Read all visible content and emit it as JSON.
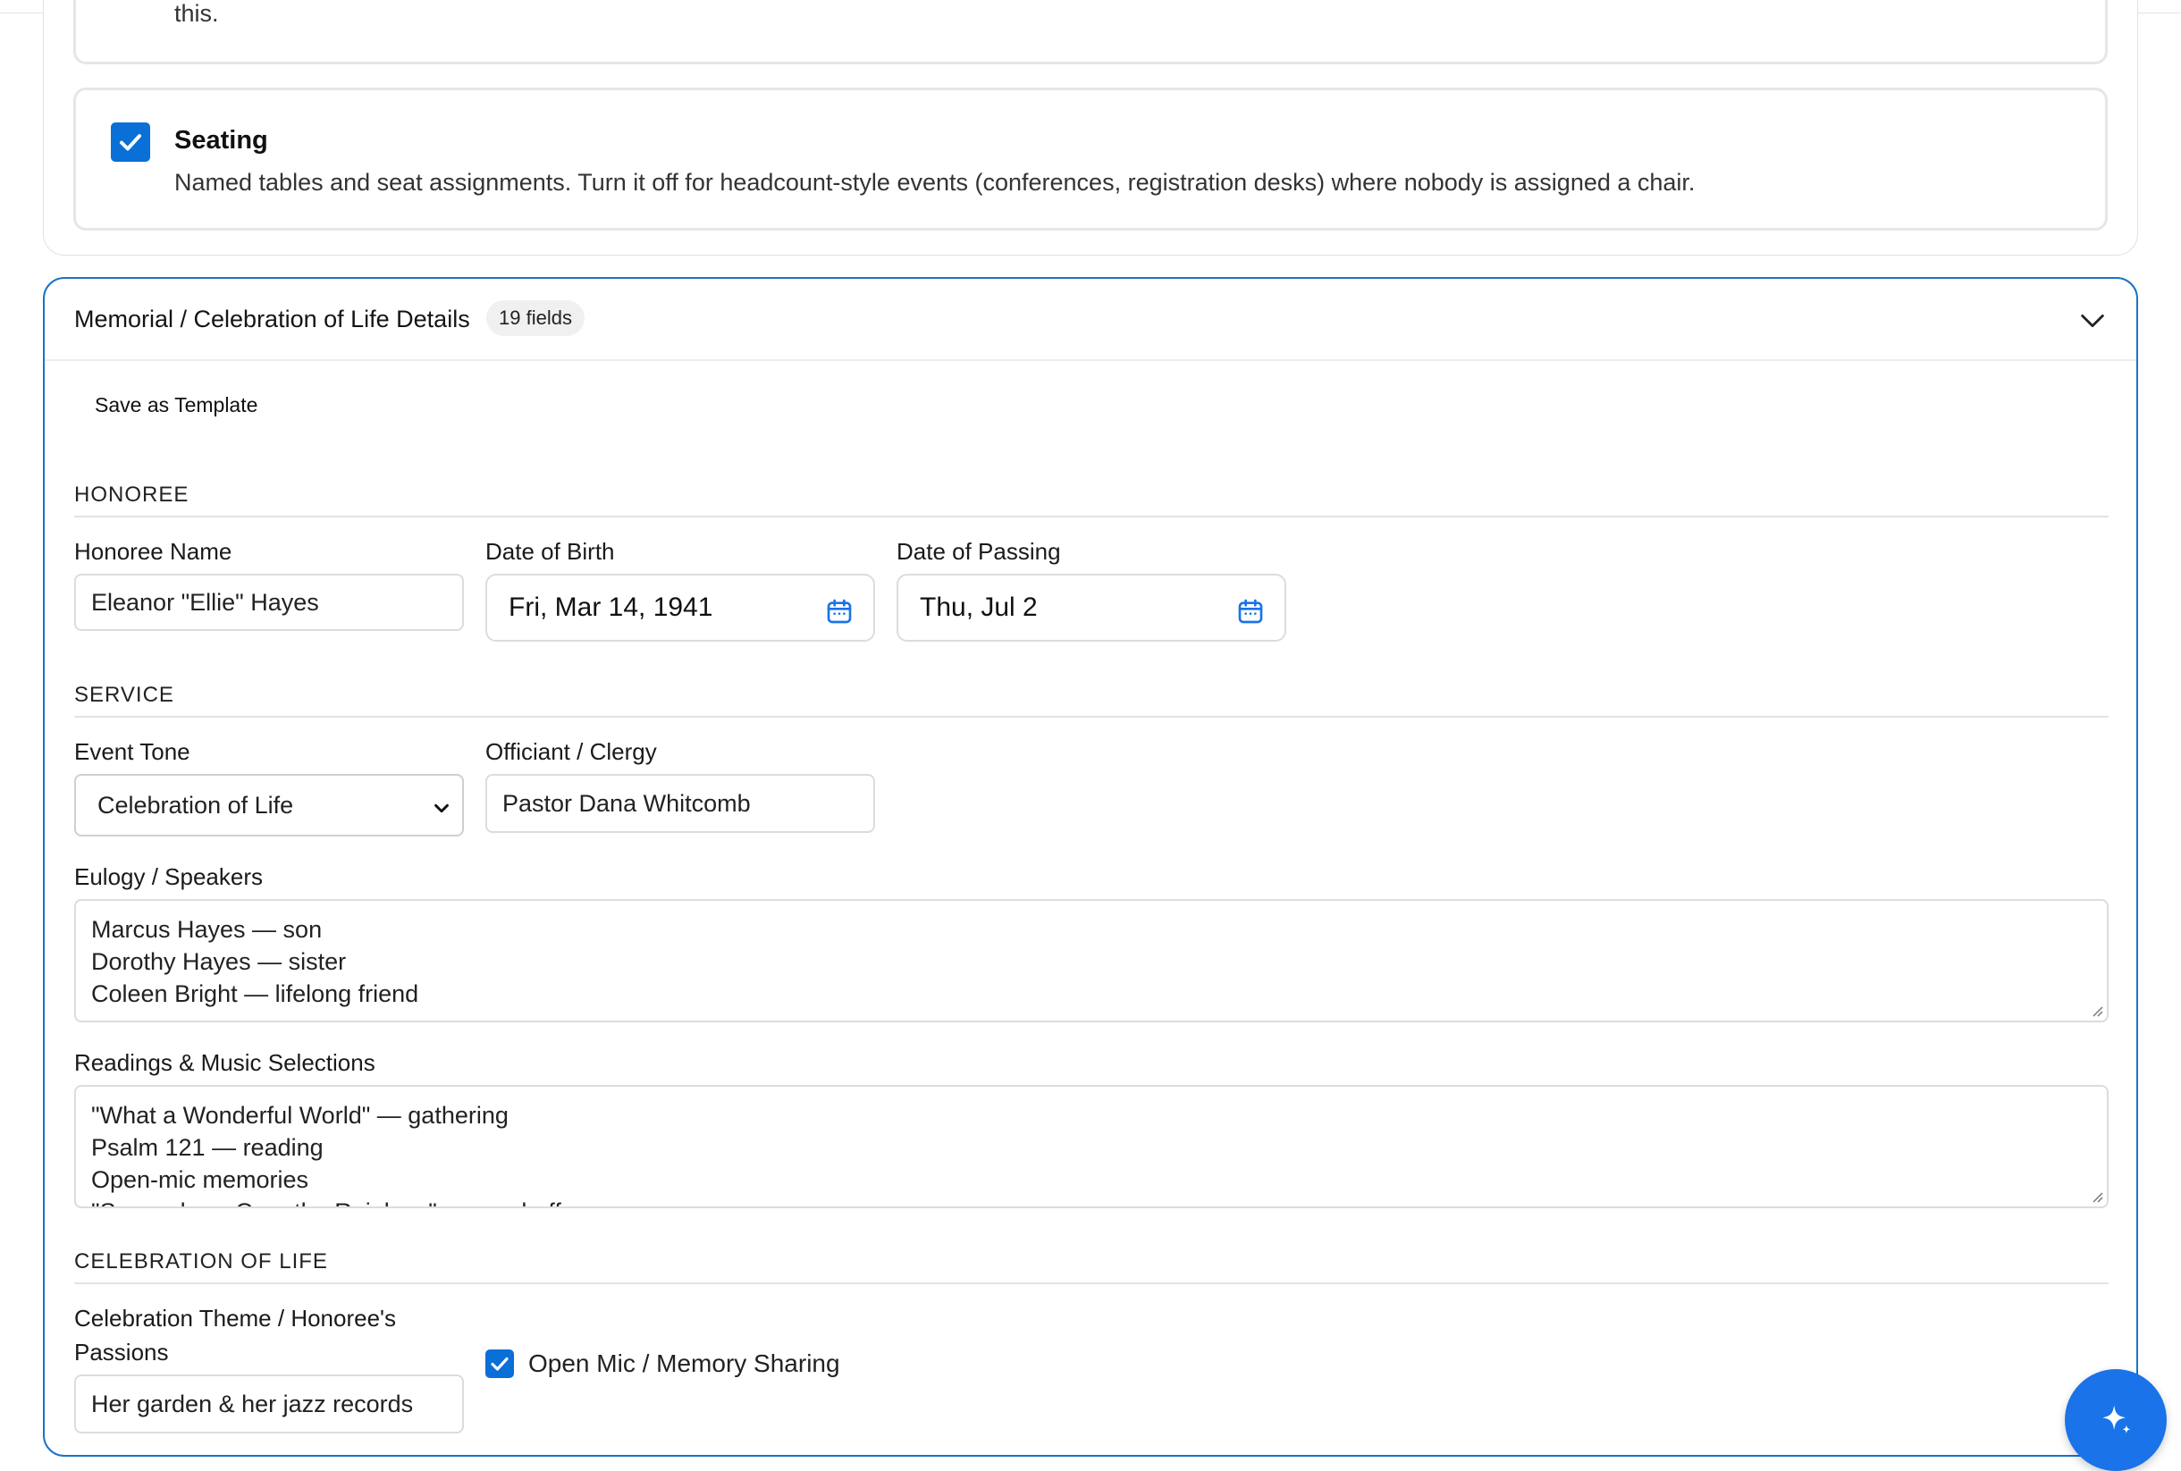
{
  "previous_section": {
    "truncated_text_tail": "this.",
    "seating": {
      "checked": true,
      "title": "Seating",
      "description": "Named tables and seat assignments. Turn it off for headcount-style events (conferences, registration desks) where nobody is assigned a chair."
    }
  },
  "memorial": {
    "title": "Memorial / Celebration of Life Details",
    "field_count_badge": "19 fields",
    "save_template_label": "Save as Template",
    "sections": {
      "honoree": "HONOREE",
      "service": "SERVICE",
      "celebration": "CELEBRATION OF LIFE"
    },
    "honoree": {
      "name_label": "Honoree Name",
      "name_value": "Eleanor \"Ellie\" Hayes",
      "dob_label": "Date of Birth",
      "dob_value": "Fri, Mar 14, 1941",
      "dop_label": "Date of Passing",
      "dop_value": "Thu, Jul 2"
    },
    "service": {
      "tone_label": "Event Tone",
      "tone_value": "Celebration of Life",
      "officiant_label": "Officiant / Clergy",
      "officiant_value": "Pastor Dana Whitcomb",
      "eulogy_label": "Eulogy / Speakers",
      "eulogy_lines": [
        "Marcus Hayes — son",
        "Dorothy Hayes — sister",
        "Coleen Bright — lifelong friend"
      ],
      "readings_label": "Readings & Music Selections",
      "readings_lines": [
        "\"What a Wonderful World\" — gathering",
        "Psalm 121 — reading",
        "Open-mic memories",
        "\"Somewhere Over the Rainbow\" — send-off"
      ]
    },
    "celebration": {
      "theme_label_line1": "Celebration Theme / Honoree's",
      "theme_label_line2": "Passions",
      "theme_value": "Her garden & her jazz records",
      "open_mic_label": "Open Mic / Memory Sharing",
      "open_mic_checked": true
    }
  },
  "icons": {
    "checkbox": "checkmark-icon",
    "calendar": "calendar-icon",
    "collapse": "chevron-down-icon",
    "select_caret": "chevron-down-icon",
    "fab": "sparkle-icon"
  },
  "colors": {
    "accent": "#1a73e8",
    "checkbox": "#0a6fd6",
    "active_border": "#1a73c7"
  }
}
